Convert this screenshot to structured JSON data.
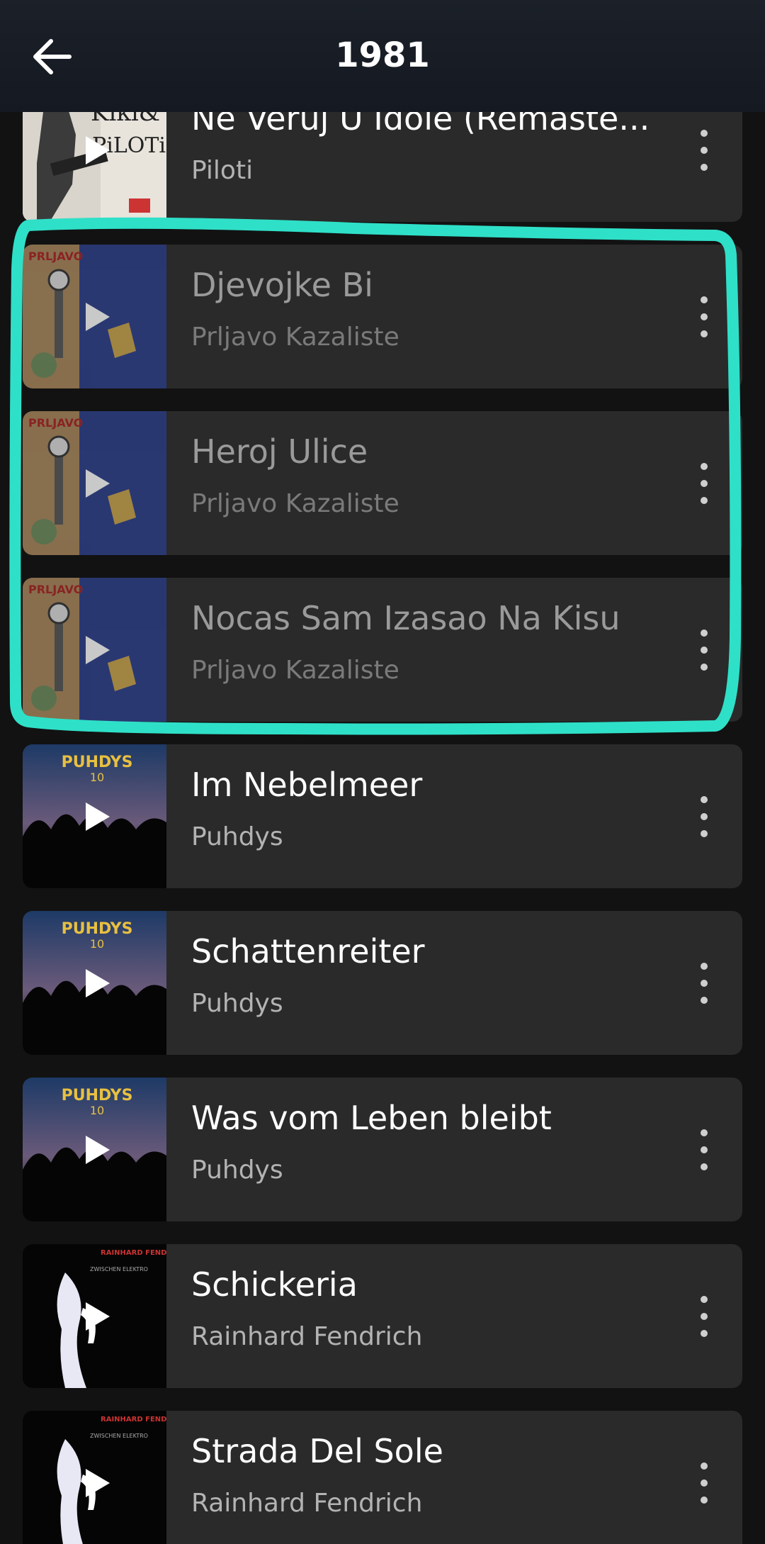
{
  "header": {
    "title": "1981",
    "back_icon": "arrow-left-icon"
  },
  "tracks": [
    {
      "title": "Ne Veruj U Idole (Remaste...",
      "artist": "Piloti",
      "cover": "kiki-piloti"
    },
    {
      "title": "Djevojke Bi",
      "artist": "Prljavo Kazaliste",
      "cover": "prljavo-kazaliste"
    },
    {
      "title": "Heroj Ulice",
      "artist": "Prljavo Kazaliste",
      "cover": "prljavo-kazaliste"
    },
    {
      "title": "Nocas Sam Izasao Na Kisu",
      "artist": "Prljavo Kazaliste",
      "cover": "prljavo-kazaliste"
    },
    {
      "title": "Im Nebelmeer",
      "artist": "Puhdys",
      "cover": "puhdys"
    },
    {
      "title": "Schattenreiter",
      "artist": "Puhdys",
      "cover": "puhdys"
    },
    {
      "title": "Was vom Leben bleibt",
      "artist": "Puhdys",
      "cover": "puhdys"
    },
    {
      "title": "Schickeria",
      "artist": "Rainhard Fendrich",
      "cover": "rainhard-fendrich"
    },
    {
      "title": "Strada Del Sole",
      "artist": "Rainhard Fendrich",
      "cover": "rainhard-fendrich"
    }
  ],
  "colors": {
    "background": "#121212",
    "row": "#2a2a2a",
    "annotation": "#2fe0c8"
  }
}
